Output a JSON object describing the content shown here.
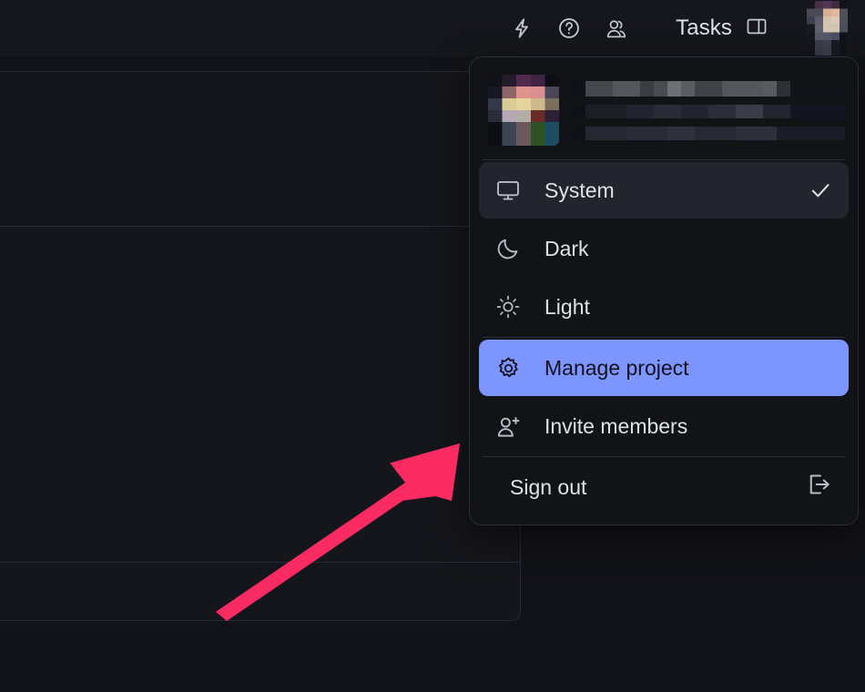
{
  "app": {
    "header": {
      "icons": [
        {
          "name": "lightning-bolt-icon",
          "label": "Quick actions"
        },
        {
          "name": "help-circle-icon",
          "label": "Help"
        },
        {
          "name": "users-icon",
          "label": "Members"
        }
      ],
      "tasks_label": "Tasks",
      "panel_toggle_name": "panel-toggle-icon",
      "avatar_name": "user-avatar"
    }
  },
  "menu": {
    "profile": {
      "avatar_name": "profile-avatar-blurred",
      "name_redacted": true,
      "email_redacted": true
    },
    "items": [
      {
        "label": "System",
        "icon": "monitor-icon",
        "state": "selected",
        "trailing": "check-icon"
      },
      {
        "label": "Dark",
        "icon": "moon-icon",
        "state": "normal",
        "trailing": ""
      },
      {
        "label": "Light",
        "icon": "sun-icon",
        "state": "normal",
        "trailing": ""
      },
      {
        "label": "Manage project",
        "icon": "gear-icon",
        "state": "active",
        "trailing": ""
      },
      {
        "label": "Invite members",
        "icon": "user-plus-icon",
        "state": "normal",
        "trailing": ""
      },
      {
        "label": "Sign out",
        "icon": "",
        "state": "normal",
        "trailing": "sign-out-icon"
      }
    ]
  },
  "annotation": {
    "arrow_name": "annotation-arrow",
    "arrow_color": "#fa2a62",
    "points_to": "Manage project"
  },
  "colors": {
    "page_background": "#121318",
    "menu_background": "#121317",
    "menu_border": "#2b2e3a",
    "selected_background": "#22242e",
    "active_background": "#7d95ff",
    "active_text": "#10111a",
    "text_primary": "#dfe1e8",
    "icon_muted": "#b9bcc7",
    "panel_border": "#272a36",
    "arrow": "#fa2a62"
  }
}
